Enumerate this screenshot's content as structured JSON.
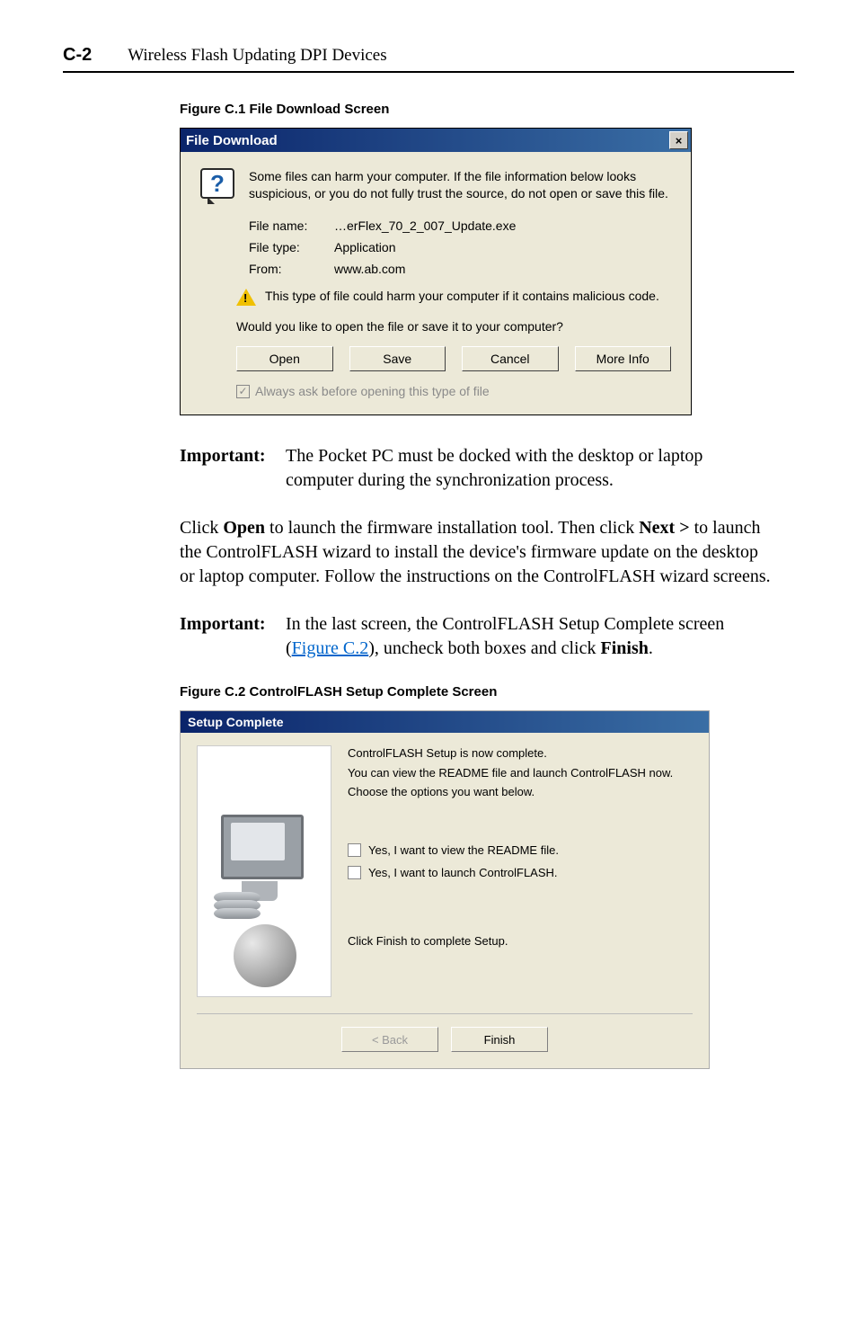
{
  "header": {
    "page_number": "C-2",
    "title": "Wireless Flash Updating DPI Devices"
  },
  "figC1": {
    "caption": "Figure C.1   File Download Screen",
    "title": "File Download",
    "close_glyph": "×",
    "question_glyph": "?",
    "intro": "Some files can harm your computer. If the file information below looks suspicious, or you do not fully trust the source, do not open or save this file.",
    "rows": {
      "filename_label": "File name:",
      "filename_value": "…erFlex_70_2_007_Update.exe",
      "filetype_label": "File type:",
      "filetype_value": "Application",
      "from_label": "From:",
      "from_value": "www.ab.com"
    },
    "warning": "This type of file could harm your computer if it contains malicious code.",
    "question": "Would you like to open the file or save it to your computer?",
    "buttons": {
      "open": "Open",
      "save": "Save",
      "cancel": "Cancel",
      "more_info": "More Info"
    },
    "always_ask": "Always ask before opening this type of file",
    "checkmark": "✓"
  },
  "important1": {
    "label": "Important:",
    "text": "The Pocket PC must be docked with the desktop or laptop computer during the synchronization process."
  },
  "para": {
    "p1a": "Click ",
    "p1b": "Open",
    "p1c": " to launch the firmware installation tool. Then click ",
    "p1d": "Next >",
    "p1e": " to launch the ControlFLASH wizard to install the device's firmware update on the desktop or laptop computer. Follow the instructions on the ControlFLASH wizard screens."
  },
  "important2": {
    "label": "Important:",
    "t1": "In the last screen, the ControlFLASH Setup Complete screen (",
    "link": "Figure C.2",
    "t2": "), uncheck both boxes and click ",
    "finish": "Finish",
    "t3": "."
  },
  "figC2": {
    "caption": "Figure C.2   ControlFLASH Setup Complete Screen",
    "title": "Setup Complete",
    "l1": "ControlFLASH Setup is now complete.",
    "l2": "You can view the README file and launch ControlFLASH now.",
    "l3": "Choose the options you want below.",
    "chk1": "Yes, I want to view the README file.",
    "chk2": "Yes, I want to launch ControlFLASH.",
    "finish_line": "Click Finish to complete Setup.",
    "back_btn": "< Back",
    "finish_btn": "Finish"
  }
}
